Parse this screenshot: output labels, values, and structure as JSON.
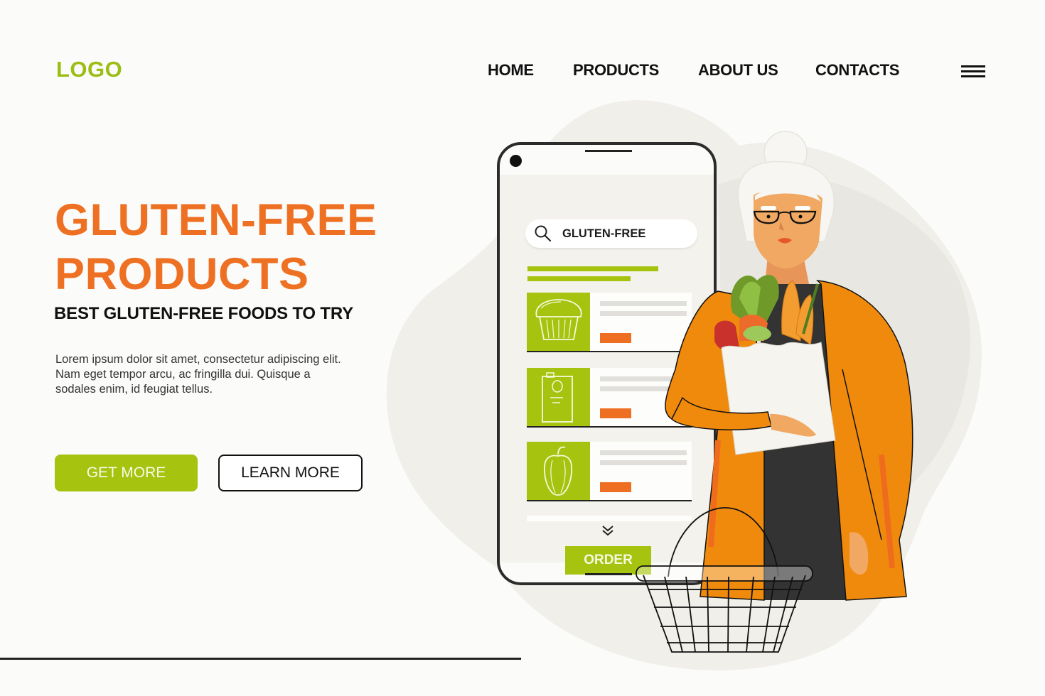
{
  "header": {
    "logo": "LOGO",
    "nav": [
      {
        "label": "HOME"
      },
      {
        "label": "PRODUCTS"
      },
      {
        "label": "ABOUT US"
      },
      {
        "label": "CONTACTS"
      }
    ],
    "menu_icon": "hamburger-menu-icon"
  },
  "hero": {
    "title_line1": "GLUTEN-FREE",
    "title_line2": "PRODUCTS",
    "subtitle": "BEST GLUTEN-FREE FOODS TO TRY",
    "body_lines": [
      "Lorem ipsum dolor sit amet, consectetur adipiscing elit.",
      "Nam eget tempor arcu, ac fringilla dui. Quisque a",
      "sodales enim, id feugiat tellus."
    ],
    "primary_button": "GET MORE",
    "secondary_button": "LEARN MORE"
  },
  "phone_app": {
    "search_icon": "search-icon",
    "search_value": "GLUTEN-FREE",
    "products": [
      {
        "icon": "muffin-icon"
      },
      {
        "icon": "milk-carton-icon"
      },
      {
        "icon": "bell-pepper-icon"
      }
    ],
    "scroll_icon": "double-chevron-down-icon",
    "order_button": "ORDER"
  },
  "illustration": {
    "figure": "elderly woman with glasses holding grocery bag of vegetables",
    "basket_icon": "shopping-basket-icon"
  },
  "colors": {
    "brand_green": "#a5c30f",
    "logo_green": "#9cbd14",
    "accent_orange": "#ee7123",
    "text_dark": "#111111",
    "background": "#fbfbfa"
  }
}
